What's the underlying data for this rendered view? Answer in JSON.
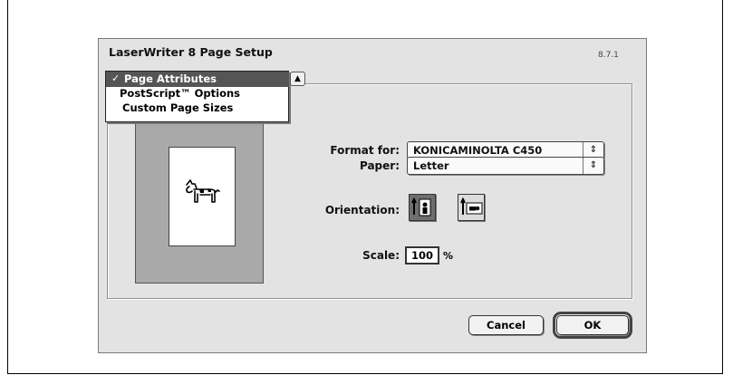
{
  "dialog": {
    "title": "LaserWriter 8 Page Setup",
    "version": "8.7.1"
  },
  "menu": {
    "items": [
      "Page Attributes",
      "PostScript™ Options",
      "Custom Page Sizes"
    ],
    "selected": "Page Attributes",
    "checkmark": "✓"
  },
  "format_for": {
    "label": "Format for:",
    "value": "KONICAMINOLTA C450"
  },
  "paper": {
    "label": "Paper:",
    "value": "Letter"
  },
  "orientation": {
    "label": "Orientation:",
    "options": [
      "portrait",
      "landscape"
    ],
    "selected": "portrait"
  },
  "scale": {
    "label": "Scale:",
    "value": "100",
    "unit": "%"
  },
  "buttons": {
    "cancel": "Cancel",
    "ok": "OK"
  },
  "icons": {
    "popup_arrows": "up-down-arrows-icon",
    "preview_image": "dogcow-icon",
    "portrait": "portrait-orientation-icon",
    "landscape": "landscape-orientation-icon"
  },
  "colors": {
    "dialog_bg": "#e3e3e3",
    "menu_highlight": "#555555",
    "preview_bg": "#a9a9a9"
  }
}
